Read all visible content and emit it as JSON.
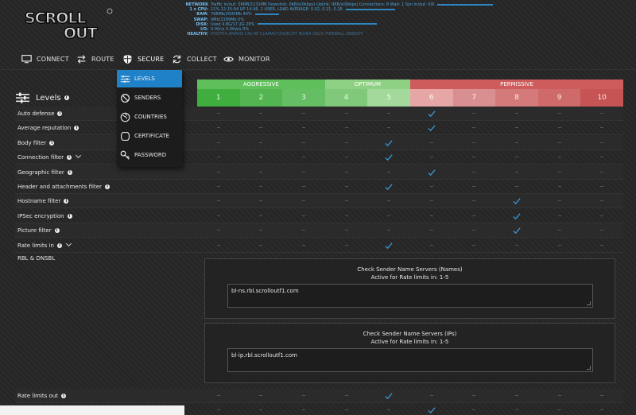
{
  "stats": [
    {
      "key": "NETWORK",
      "value": "Traffic in/out: 56MB/1231MB   Downlink: 0KB/s(0kbps)   Uplink: 0KB/s(0kbps)   Connections: 8   Wait: 1   Syn in/out: 0/0"
    },
    {
      "key": "1 x CPU:",
      "value": "11%  12:15:04 UP 14:36, 1 USER, LOAD AVERAGE: 0.02, 0.21, 0.26"
    },
    {
      "key": "RAM:",
      "value": "798Mb/2000Mb 40%"
    },
    {
      "key": "SWAP:",
      "value": "0Mb/1399Mb 0%"
    },
    {
      "key": "DISK:",
      "value": "Used 4.8G/17.2G 28%"
    },
    {
      "key": "I/O:",
      "value": "0.00r/s 0.00w/s 0%"
    },
    {
      "key": "HEALTHY:",
      "value": "POSTFIX   AMAVIS   CACHE   CLAMAV   DOVECOT   NGINX   OSCH   FIREWALL   REBOOT"
    }
  ],
  "nav": [
    {
      "label": "CONNECT",
      "icon": "monitor-icon"
    },
    {
      "label": "ROUTE",
      "icon": "arrows-icon"
    },
    {
      "label": "SECURE",
      "icon": "shield-icon"
    },
    {
      "label": "COLLECT",
      "icon": "refresh-icon"
    },
    {
      "label": "MONITOR",
      "icon": "eye-icon"
    }
  ],
  "dropdown": [
    {
      "label": "LEVELS",
      "icon": "sliders-icon",
      "active": true
    },
    {
      "label": "SENDERS",
      "icon": "block-icon"
    },
    {
      "label": "COUNTRIES",
      "icon": "globe-icon"
    },
    {
      "label": "CERTIFICATE",
      "icon": "badge-icon"
    },
    {
      "label": "PASSWORD",
      "icon": "key-icon"
    }
  ],
  "levels_title": "Levels",
  "info_glyph": "i",
  "groups": [
    {
      "label": "AGGRESSIVE",
      "color": "#5fbf5a"
    },
    {
      "label": "OPTIMUM",
      "color": "#8fd184"
    },
    {
      "label": "PERMISSIVE",
      "color": "#cf5c5c"
    }
  ],
  "levels": [
    "1",
    "2",
    "3",
    "4",
    "5",
    "6",
    "7",
    "8",
    "9",
    "10"
  ],
  "level_colors": [
    "#3fae3f",
    "#52b552",
    "#65be63",
    "#80c97a",
    "#a3d99a",
    "#e6a6a6",
    "#d98f8f",
    "#d47a7a",
    "#cf6a6a",
    "#c75454"
  ],
  "rows": [
    {
      "label": "Auto defense",
      "info": true,
      "chevron": false,
      "level": 6
    },
    {
      "label": "Average reputation",
      "info": true,
      "chevron": false,
      "level": 6
    },
    {
      "label": "Body filter",
      "info": true,
      "chevron": false,
      "level": 5
    },
    {
      "label": "Connection filter",
      "info": true,
      "chevron": true,
      "level": 5
    },
    {
      "label": "Geographic filter",
      "info": true,
      "chevron": false,
      "level": 6
    },
    {
      "label": "Header and attachments filter",
      "info": true,
      "chevron": false,
      "level": 5
    },
    {
      "label": "Hostname filter",
      "info": true,
      "chevron": false,
      "level": 8
    },
    {
      "label": "IPSec encryption",
      "info": true,
      "chevron": false,
      "level": 8
    },
    {
      "label": "Picture filter",
      "info": true,
      "chevron": false,
      "level": 8
    },
    {
      "label": "Rate limits in",
      "info": true,
      "chevron": true,
      "level": 5
    }
  ],
  "rbl": {
    "label": "RBL & DNSBL",
    "panels": [
      {
        "title": "Check Sender Name Servers (Names)",
        "subtitle": "Active for Rate limits in: 1-5",
        "value": "bl-ns.rbl.scrolloutf1.com"
      },
      {
        "title": "Check Sender Name Servers (IPs)",
        "subtitle": "Active for Rate limits in: 1-5",
        "value": "bl-ip.rbl.scrolloutf1.com"
      }
    ]
  },
  "bottom_rows": [
    {
      "label": "Rate limits out",
      "info": true,
      "level": 5
    },
    {
      "label": "",
      "info": false,
      "level": 6
    }
  ],
  "accent": "#1f82c9",
  "check_color": "#3a9ad9"
}
